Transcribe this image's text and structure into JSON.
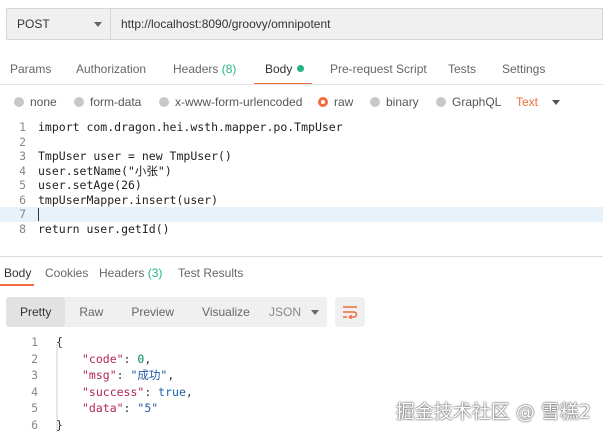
{
  "request": {
    "method": "POST",
    "url": "http://localhost:8090/groovy/omnipotent"
  },
  "request_tabs": {
    "params": "Params",
    "authorization": "Authorization",
    "headers_label": "Headers",
    "headers_count": "(8)",
    "body": "Body",
    "prerequest": "Pre-request Script",
    "tests": "Tests",
    "settings": "Settings"
  },
  "body_types": {
    "none": "none",
    "form_data": "form-data",
    "urlencoded": "x-www-form-urlencoded",
    "raw": "raw",
    "binary": "binary",
    "graphql": "GraphQL",
    "text_format": "Text"
  },
  "editor": {
    "lines": [
      {
        "num": "1",
        "text": "import com.dragon.hei.wsth.mapper.po.TmpUser"
      },
      {
        "num": "2",
        "text": ""
      },
      {
        "num": "3",
        "text": "TmpUser user = new TmpUser()"
      },
      {
        "num": "4",
        "text": "user.setName(\"小张\")"
      },
      {
        "num": "5",
        "text": "user.setAge(26)"
      },
      {
        "num": "6",
        "text": "tmpUserMapper.insert(user)"
      },
      {
        "num": "7",
        "text": ""
      },
      {
        "num": "8",
        "text": "return user.getId()"
      }
    ]
  },
  "response_tabs": {
    "body": "Body",
    "cookies": "Cookies",
    "headers_label": "Headers",
    "headers_count": "(3)",
    "test_results": "Test Results"
  },
  "response_toolbar": {
    "pretty": "Pretty",
    "raw": "Raw",
    "preview": "Preview",
    "visualize": "Visualize",
    "format": "JSON"
  },
  "response_body": {
    "l1": {
      "num": "1",
      "open": "{"
    },
    "l2": {
      "num": "2",
      "key": "\"code\"",
      "colon": ": ",
      "value": "0",
      "comma": ","
    },
    "l3": {
      "num": "3",
      "key": "\"msg\"",
      "colon": ": ",
      "value": "\"成功\"",
      "comma": ","
    },
    "l4": {
      "num": "4",
      "key": "\"success\"",
      "colon": ": ",
      "value": "true",
      "comma": ","
    },
    "l5": {
      "num": "5",
      "key": "\"data\"",
      "colon": ": ",
      "value": "\"5\""
    },
    "l6": {
      "num": "6",
      "close": "}"
    }
  },
  "watermark": "掘金技术社区 @ 雪糕2",
  "colors": {
    "accent": "#f26b3a",
    "green": "#26b47f"
  }
}
